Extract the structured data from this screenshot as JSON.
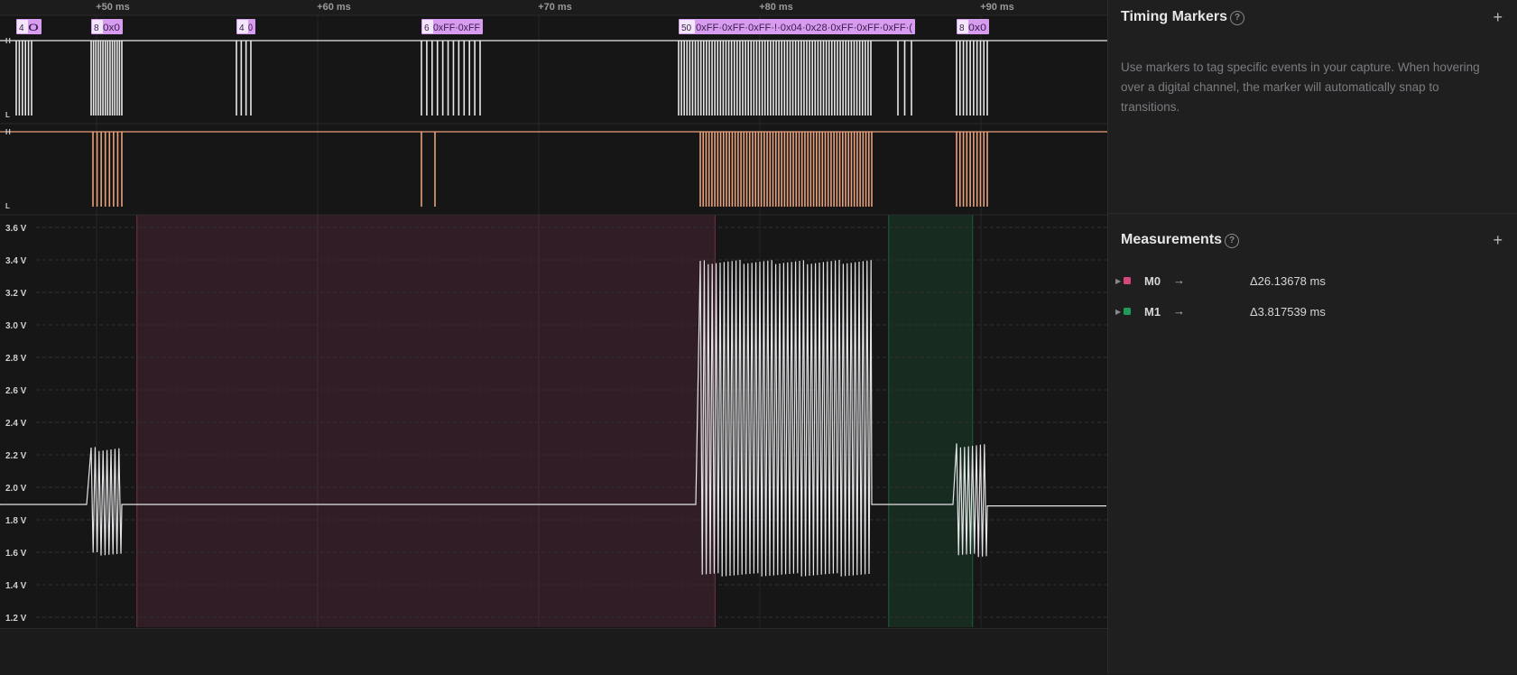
{
  "timeline": {
    "ticks": [
      {
        "label": "+50 ms",
        "ms": 50
      },
      {
        "label": "+60 ms",
        "ms": 60
      },
      {
        "label": "+70 ms",
        "ms": 70
      },
      {
        "label": "+80 ms",
        "ms": 80
      },
      {
        "label": "+90 ms",
        "ms": 90
      }
    ]
  },
  "digital_channels": [
    {
      "high_label": "H",
      "low_label": "L",
      "color": "#e8e8e8"
    },
    {
      "high_label": "H",
      "low_label": "L",
      "color": "#e9a17c"
    }
  ],
  "decoder_labels": [
    {
      "prefix": "4",
      "text": "0"
    },
    {
      "prefix": "8",
      "text": "0x0"
    },
    {
      "prefix": "4",
      "text": "0"
    },
    {
      "prefix": "6",
      "text": "0xFF·0xFF"
    },
    {
      "prefix": "50",
      "text": "0xFF·0xFF·0xFF·!·0x04·0x28·0xFF·0xFF·0xFF·("
    },
    {
      "prefix": "8",
      "text": "0x0"
    }
  ],
  "analog_axis": {
    "labels": [
      "3.6 V",
      "3.4 V",
      "3.2 V",
      "3.0 V",
      "2.8 V",
      "2.6 V",
      "2.4 V",
      "2.2 V",
      "2.0 V",
      "1.8 V",
      "1.6 V",
      "1.4 V",
      "1.2 V"
    ],
    "vmax": 3.6,
    "vmin": 1.2
  },
  "measurement_regions": [
    {
      "name": "M0",
      "start_ms": 50.6,
      "end_ms": 76.75,
      "color": "#c2466f"
    },
    {
      "name": "M1",
      "start_ms": 84.6,
      "end_ms": 88.4,
      "color": "#1f9a58"
    }
  ],
  "panel": {
    "timing_markers": {
      "title": "Timing Markers",
      "help": "?",
      "add": "+",
      "description": "Use markers to tag specific events in your capture. When hovering over a digital channel, the marker will automatically snap to transitions."
    },
    "measurements": {
      "title": "Measurements",
      "help": "?",
      "add": "+",
      "items": [
        {
          "name": "M0",
          "arrow": "→",
          "value": "Δ26.13678 ms",
          "color": "#d6457e"
        },
        {
          "name": "M1",
          "arrow": "→",
          "value": "Δ3.817539 ms",
          "color": "#1f9a58"
        }
      ]
    }
  }
}
